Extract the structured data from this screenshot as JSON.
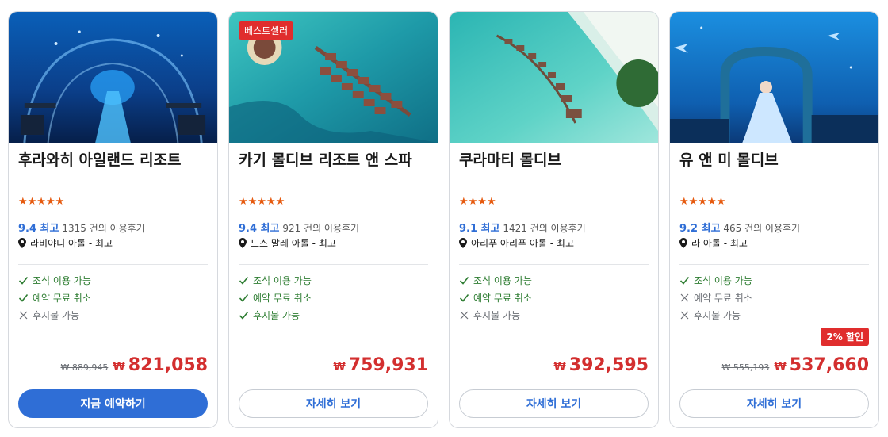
{
  "colors": {
    "accent": "#2f6ed6",
    "price": "#d32f2f",
    "star": "#e65a0f",
    "ok": "#2e7d32",
    "badge": "#e02d2d"
  },
  "currency_symbol": "₩",
  "cards": [
    {
      "name": "후라와히 아일랜드 리조트",
      "stars": "★★★★★",
      "score": "9.4 최고",
      "reviews": "1315 건의 이용후기",
      "location": "라비야니 아톨 - 최고",
      "features": [
        {
          "label": "조식 이용 가능",
          "available": true
        },
        {
          "label": "예약 무료 취소",
          "available": true
        },
        {
          "label": "후지불 가능",
          "available": false
        }
      ],
      "old_price": "₩ 889,945",
      "price": "821,058",
      "button": "지금 예약하기",
      "image": "underwater-restaurant"
    },
    {
      "badge": "베스트셀러",
      "name": "카기 몰디브 리조트 앤 스파",
      "stars": "★★★★★",
      "score": "9.4 최고",
      "reviews": "921 건의 이용후기",
      "location": "노스 말레 아톨 - 최고",
      "features": [
        {
          "label": "조식 이용 가능",
          "available": true
        },
        {
          "label": "예약 무료 취소",
          "available": true
        },
        {
          "label": "후지불 가능",
          "available": true
        }
      ],
      "price": "759,931",
      "button": "자세히 보기",
      "image": "aerial-water-villas"
    },
    {
      "name": "쿠라마티 몰디브",
      "stars": "★★★★",
      "score": "9.1 최고",
      "reviews": "1421 건의 이용후기",
      "location": "아리푸 아리푸 아톨 - 최고",
      "features": [
        {
          "label": "조식 이용 가능",
          "available": true
        },
        {
          "label": "예약 무료 취소",
          "available": true
        },
        {
          "label": "후지불 가능",
          "available": false
        }
      ],
      "price": "392,595",
      "button": "자세히 보기",
      "image": "island-aerial"
    },
    {
      "name": "유 앤 미 몰디브",
      "stars": "★★★★★",
      "score": "9.2 최고",
      "reviews": "465 건의 이용후기",
      "location": "라 아톨 - 최고",
      "features": [
        {
          "label": "조식 이용 가능",
          "available": true
        },
        {
          "label": "예약 무료 취소",
          "available": false
        },
        {
          "label": "후지불 가능",
          "available": false
        }
      ],
      "discount_badge": "2% 할인",
      "old_price": "₩ 555,193",
      "price": "537,660",
      "button": "자세히 보기",
      "image": "underwater-lounge"
    }
  ]
}
